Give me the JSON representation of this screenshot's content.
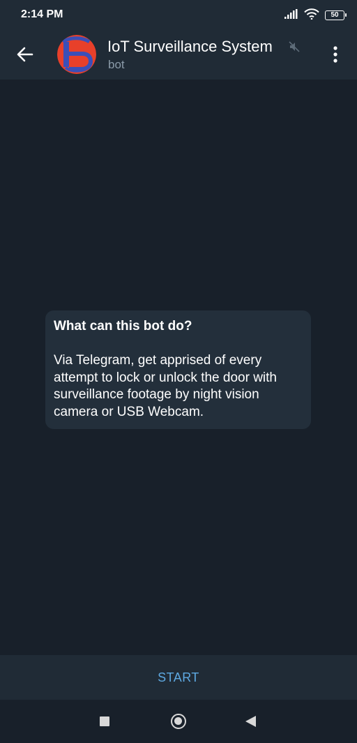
{
  "status_bar": {
    "time": "2:14 PM",
    "battery_level": "50",
    "icons": [
      "signal-icon",
      "wifi-icon",
      "battery-icon"
    ]
  },
  "header": {
    "title": "IoT Surveillance System",
    "subtitle": "bot",
    "icons": [
      "back-arrow-icon",
      "bot-avatar",
      "muted-icon",
      "more-vertical-icon"
    ]
  },
  "intro": {
    "title": "What can this bot do?",
    "description": "Via Telegram, get apprised of every attempt to lock or unlock the door with surveillance footage by night vision camera or USB Webcam."
  },
  "bottom": {
    "start_label": "START"
  },
  "navigation": {
    "icons": [
      "recents-icon",
      "home-icon",
      "back-icon"
    ]
  },
  "colors": {
    "background": "#18202a",
    "header": "#202b36",
    "card": "#232f3b",
    "accent": "#5ea9e2",
    "subtitle": "#8b9ba9",
    "avatar_red": "#e8402a",
    "avatar_blue": "#3b4fb8"
  }
}
